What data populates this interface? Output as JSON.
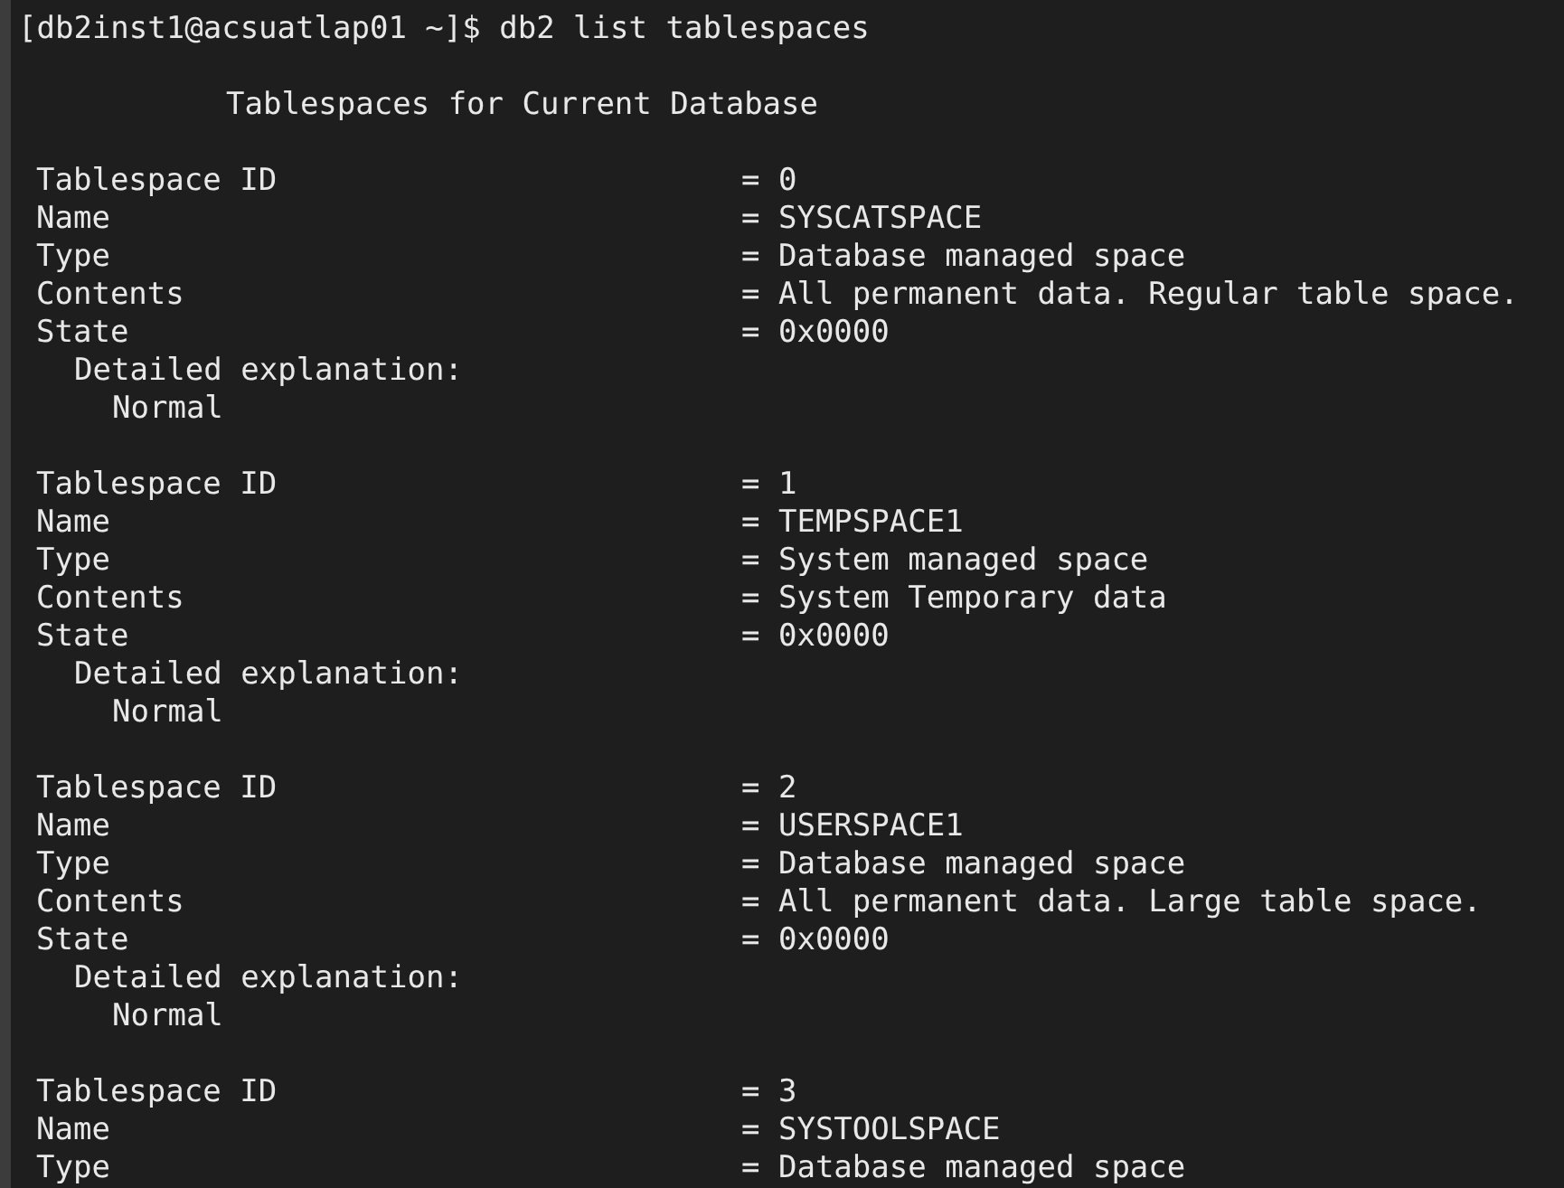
{
  "prompt": {
    "text": "[db2inst1@acsuatlap01 ~]$ db2 list tablespaces"
  },
  "heading": "Tablespaces for Current Database",
  "records": [
    {
      "fields": [
        {
          "label": "Tablespace ID",
          "value": "= 0"
        },
        {
          "label": "Name",
          "value": "= SYSCATSPACE"
        },
        {
          "label": "Type",
          "value": "= Database managed space"
        },
        {
          "label": "Contents",
          "value": "= All permanent data. Regular table space."
        },
        {
          "label": "State",
          "value": "= 0x0000"
        }
      ],
      "explanation_label": "Detailed explanation:",
      "explanation": "Normal"
    },
    {
      "fields": [
        {
          "label": "Tablespace ID",
          "value": "= 1"
        },
        {
          "label": "Name",
          "value": "= TEMPSPACE1"
        },
        {
          "label": "Type",
          "value": "= System managed space"
        },
        {
          "label": "Contents",
          "value": "= System Temporary data"
        },
        {
          "label": "State",
          "value": "= 0x0000"
        }
      ],
      "explanation_label": "Detailed explanation:",
      "explanation": "Normal"
    },
    {
      "fields": [
        {
          "label": "Tablespace ID",
          "value": "= 2"
        },
        {
          "label": "Name",
          "value": "= USERSPACE1"
        },
        {
          "label": "Type",
          "value": "= Database managed space"
        },
        {
          "label": "Contents",
          "value": "= All permanent data. Large table space."
        },
        {
          "label": "State",
          "value": "= 0x0000"
        }
      ],
      "explanation_label": "Detailed explanation:",
      "explanation": "Normal"
    },
    {
      "fields": [
        {
          "label": "Tablespace ID",
          "value": "= 3"
        },
        {
          "label": "Name",
          "value": "= SYSTOOLSPACE"
        },
        {
          "label": "Type",
          "value": "= Database managed space"
        }
      ]
    }
  ]
}
